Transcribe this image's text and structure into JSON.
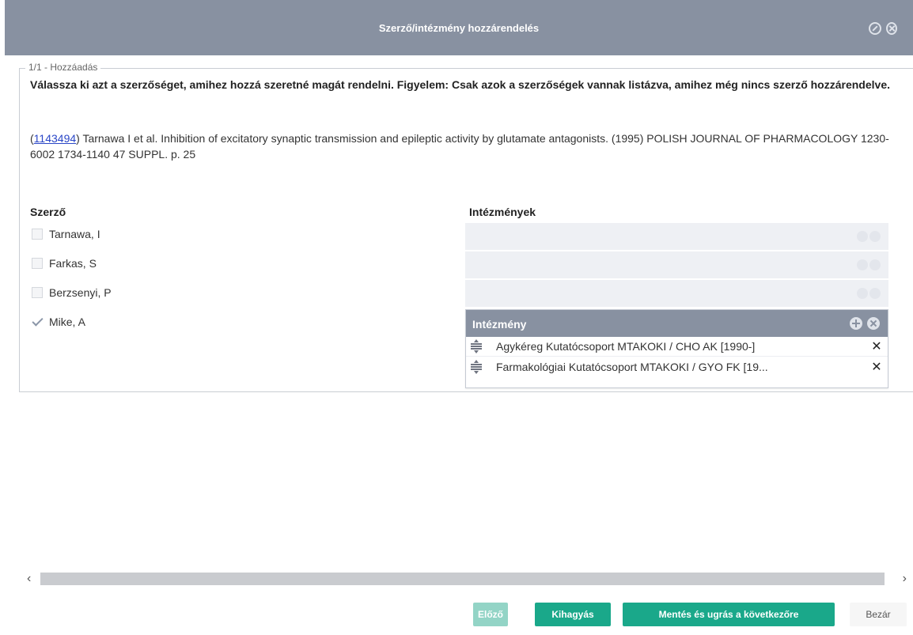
{
  "dialog": {
    "title": "Szerző/intézmény hozzárendelés",
    "minimize_icon": "minimize-icon",
    "close_icon": "close-icon"
  },
  "step": {
    "legend": "1/1 - Hozzáadás",
    "instructions": "Válassza ki azt a szerzőséget, amihez hozzá szeretné magát rendelni. Figyelem: Csak azok a szerzőségek vannak listázva, amihez még nincs szerző hozzárendelve.",
    "citation_id": "1143494",
    "citation_text": " Tarnawa I et al. Inhibition of excitatory synaptic transmission and epileptic activity by glutamate antagonists. (1995) POLISH JOURNAL OF PHARMACOLOGY 1230-6002 1734-1140 47 SUPPL. p. 25"
  },
  "authors": {
    "heading": "Szerző",
    "items": [
      {
        "label": "Tarnawa, I",
        "checked": false
      },
      {
        "label": "Farkas, S",
        "checked": false
      },
      {
        "label": "Berzsenyi, P",
        "checked": false
      },
      {
        "label": "Mike, A",
        "checked": true
      }
    ]
  },
  "institutions": {
    "heading": "Intézmények",
    "panel_title": "Intézmény",
    "add_icon": "plus-circle-icon",
    "remove_icon": "x-circle-icon",
    "rows": [
      {
        "name": "Agykéreg Kutatócsoport MTAKOKI / CHO AK [1990-]"
      },
      {
        "name": "Farmakológiai Kutatócsoport MTAKOKI / GYO FK [19..."
      }
    ],
    "remove_label": "✕",
    "drag_icon": "drag-handle-icon"
  },
  "footer": {
    "prev_label": "Előző",
    "skip_label": "Kihagyás",
    "save_next_label": "Mentés és ugrás a következőre",
    "close_label": "Bezár"
  },
  "scroll": {
    "left_arrow": "‹",
    "right_arrow": "›"
  },
  "colors": {
    "titlebar": "#8891a1",
    "primary": "#1aa88a",
    "primary_disabled": "#93d4c6",
    "link": "#2a46c7"
  }
}
